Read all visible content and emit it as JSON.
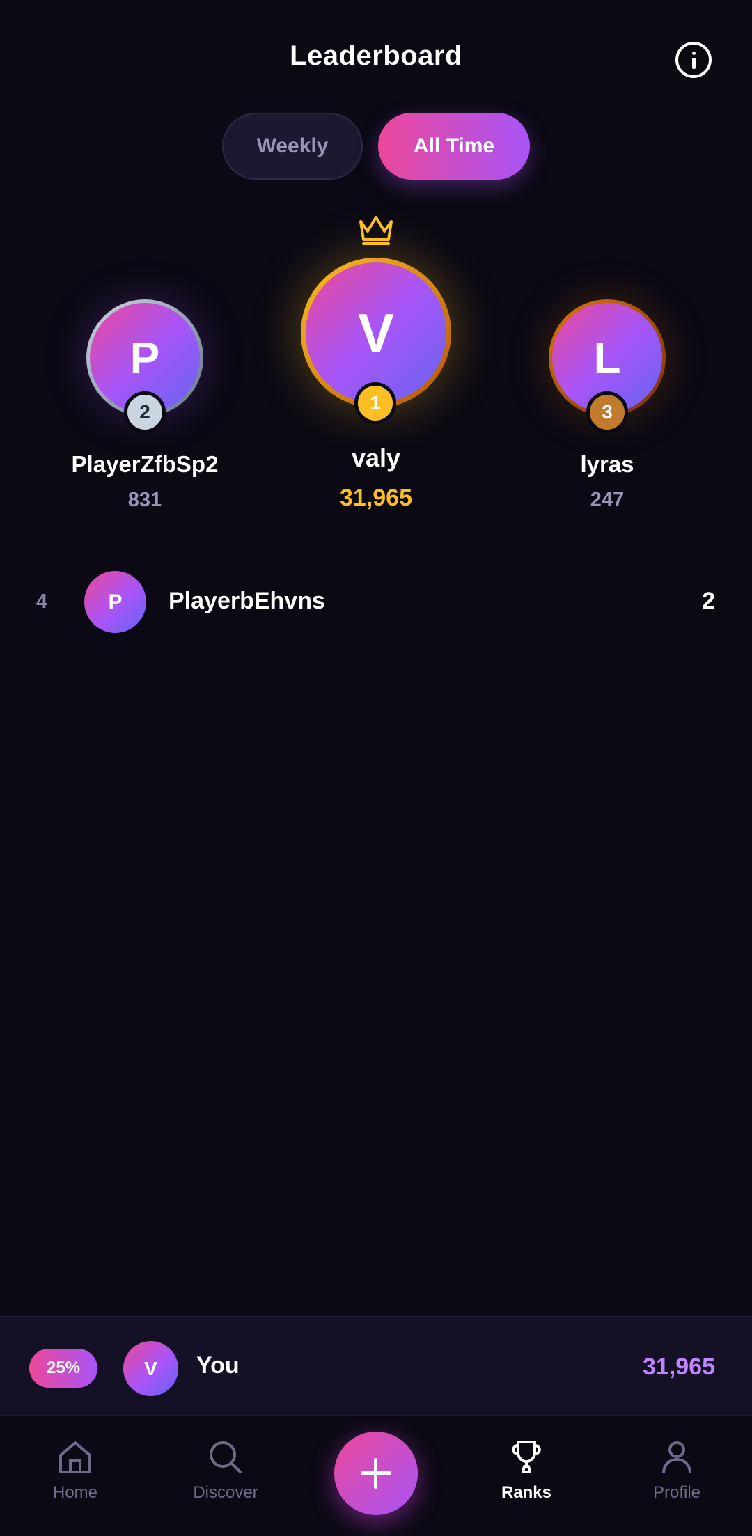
{
  "header": {
    "title": "Leaderboard",
    "info_icon": "info-icon"
  },
  "tabs": [
    {
      "label": "Weekly",
      "active": false
    },
    {
      "label": "All Time",
      "active": true
    }
  ],
  "podium": {
    "first": {
      "rank": "1",
      "initial": "V",
      "name": "valy",
      "score": "31,965"
    },
    "second": {
      "rank": "2",
      "initial": "P",
      "name": "PlayerZfbSp2",
      "score": "831"
    },
    "third": {
      "rank": "3",
      "initial": "L",
      "name": "lyras",
      "score": "247"
    }
  },
  "list": [
    {
      "rank": "4",
      "initial": "P",
      "name": "PlayerbEhvns",
      "score": "2"
    }
  ],
  "you": {
    "percent": "25%",
    "initial": "V",
    "label": "You",
    "score": "31,965"
  },
  "nav": {
    "items": [
      {
        "label": "Home",
        "icon": "home-icon"
      },
      {
        "label": "Discover",
        "icon": "search-icon"
      },
      {
        "label": "Ranks",
        "icon": "trophy-icon",
        "active": true
      },
      {
        "label": "Profile",
        "icon": "user-icon"
      }
    ]
  },
  "colors": {
    "accent_pink": "#ec4899",
    "accent_purple": "#a855f7",
    "gold": "#fbbf24",
    "background": "#0b0914"
  }
}
